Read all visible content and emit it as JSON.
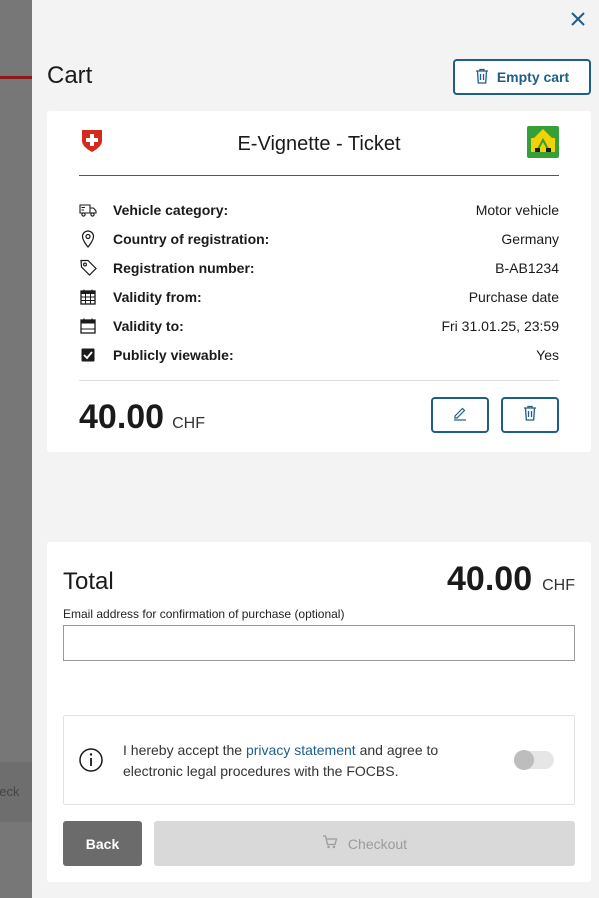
{
  "background": {
    "partial_text": "heck"
  },
  "drawer": {
    "close_icon": "close-icon",
    "title": "Cart",
    "empty_cart_label": "Empty cart"
  },
  "ticket": {
    "title": "E-Vignette - Ticket",
    "rows": [
      {
        "icon": "truck-icon",
        "label": "Vehicle category:",
        "value": "Motor vehicle"
      },
      {
        "icon": "location-pin-icon",
        "label": "Country of registration:",
        "value": "Germany"
      },
      {
        "icon": "tag-icon",
        "label": "Registration number:",
        "value": "B-AB1234"
      },
      {
        "icon": "calendar-grid-icon",
        "label": "Validity from:",
        "value": "Purchase date"
      },
      {
        "icon": "calendar-icon",
        "label": "Validity to:",
        "value": "Fri 31.01.25, 23:59"
      },
      {
        "icon": "checkbox-checked-icon",
        "label": "Publicly viewable:",
        "value": "Yes"
      }
    ],
    "price": "40.00",
    "currency": "CHF"
  },
  "summary": {
    "total_label": "Total",
    "total_amount": "40.00",
    "currency": "CHF",
    "email_label": "Email address for confirmation of purchase (optional)",
    "email_value": "",
    "consent_prefix": "I hereby accept the ",
    "consent_link": "privacy statement",
    "consent_suffix": " and agree to electronic legal procedures with the FOCBS.",
    "consent_toggle_on": false,
    "back_label": "Back",
    "checkout_label": "Checkout"
  },
  "colors": {
    "accent": "#1e5f8a",
    "swiss_red": "#d52b1e",
    "vignette_green": "#35a037",
    "vignette_yellow": "#f2d200"
  }
}
